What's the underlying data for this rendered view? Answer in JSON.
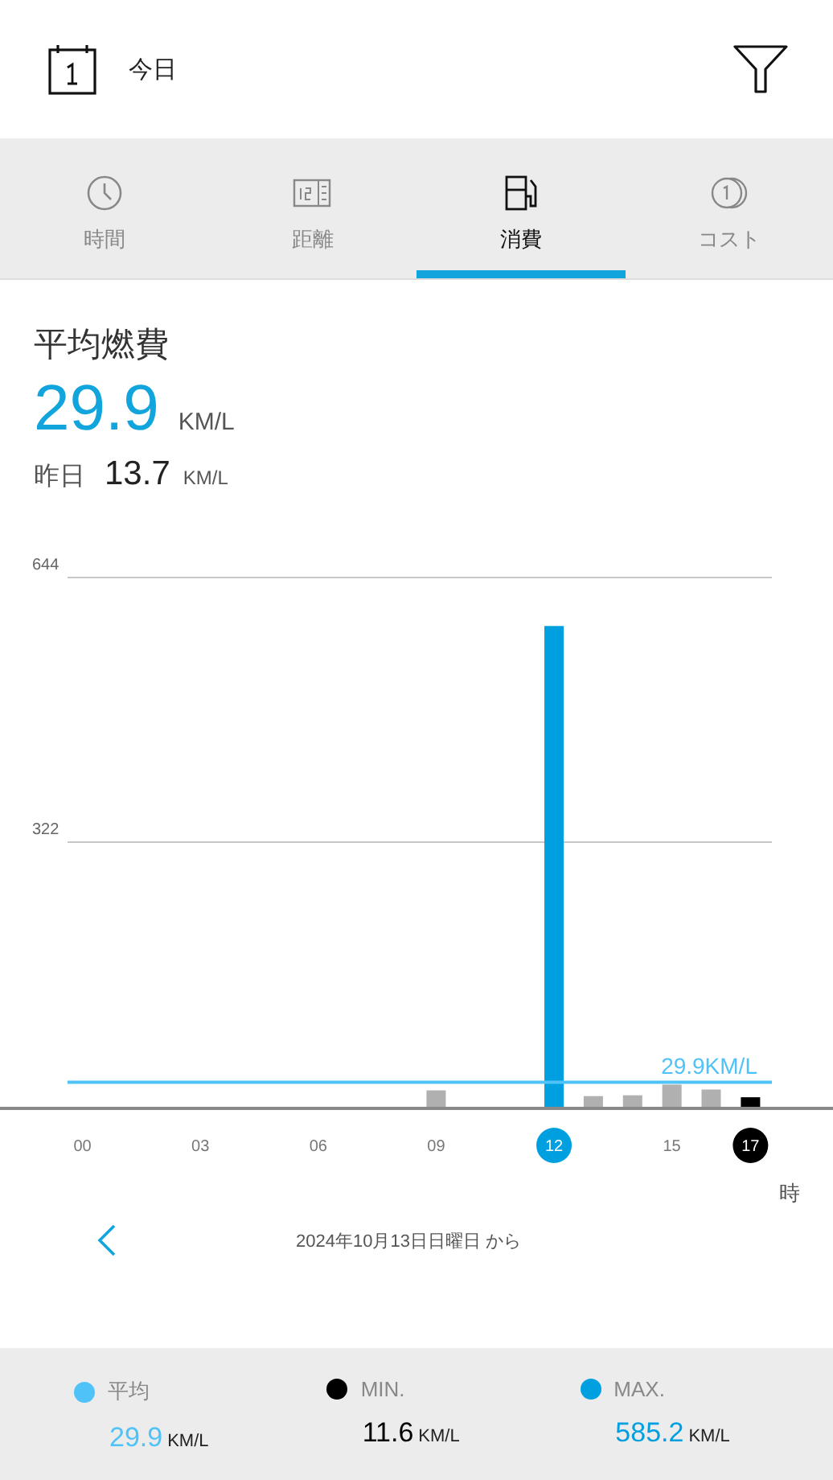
{
  "header": {
    "date_label": "今日"
  },
  "tabs": [
    {
      "kind": "clock",
      "label": "時間",
      "selected": false
    },
    {
      "kind": "counter",
      "label": "距離",
      "selected": false
    },
    {
      "kind": "fuel",
      "label": "消費",
      "selected": true
    },
    {
      "kind": "coins",
      "label": "コスト",
      "selected": false
    }
  ],
  "summary": {
    "title": "平均燃費",
    "value": "29.9",
    "unit": "KM/L",
    "yesterday_label": "昨日",
    "yesterday_value": "13.7",
    "yesterday_unit": "KM/L"
  },
  "chart": {
    "chart_data": {
      "type": "bar",
      "xlabel": "時",
      "x": [
        9,
        10,
        11,
        12,
        13,
        14,
        15,
        16,
        17
      ],
      "values": [
        20,
        null,
        null,
        585,
        13,
        14,
        27,
        21,
        11.6
      ],
      "xlim": [
        -2.1,
        19.1
      ],
      "ylim": [
        0,
        644
      ],
      "yticks": [
        322,
        644
      ],
      "xticks": [
        {
          "value": 0,
          "label": "00"
        },
        {
          "value": 3,
          "label": "03"
        },
        {
          "value": 6,
          "label": "06"
        },
        {
          "value": 9,
          "label": "09"
        },
        {
          "value": 12,
          "label": "12"
        },
        {
          "value": 15,
          "label": "15"
        },
        {
          "value": 17,
          "label": "17"
        }
      ],
      "ref_lines": [
        {
          "axis": "y",
          "value": 29.9,
          "label": "29.9KM/L",
          "color": "#4fc3f7"
        }
      ]
    }
  },
  "period": {
    "text": "2024年10月13日日曜日 から"
  },
  "legend": [
    {
      "label": "平均",
      "color": "#4fc3f7",
      "value": "29.9",
      "unit": "KM/L"
    },
    {
      "label": "MIN.",
      "color": "#000000",
      "value": "11.6",
      "unit": "KM/L"
    },
    {
      "label": "MAX.",
      "color": "#00a0e0",
      "value": "585.2",
      "unit": "KM/L"
    }
  ]
}
